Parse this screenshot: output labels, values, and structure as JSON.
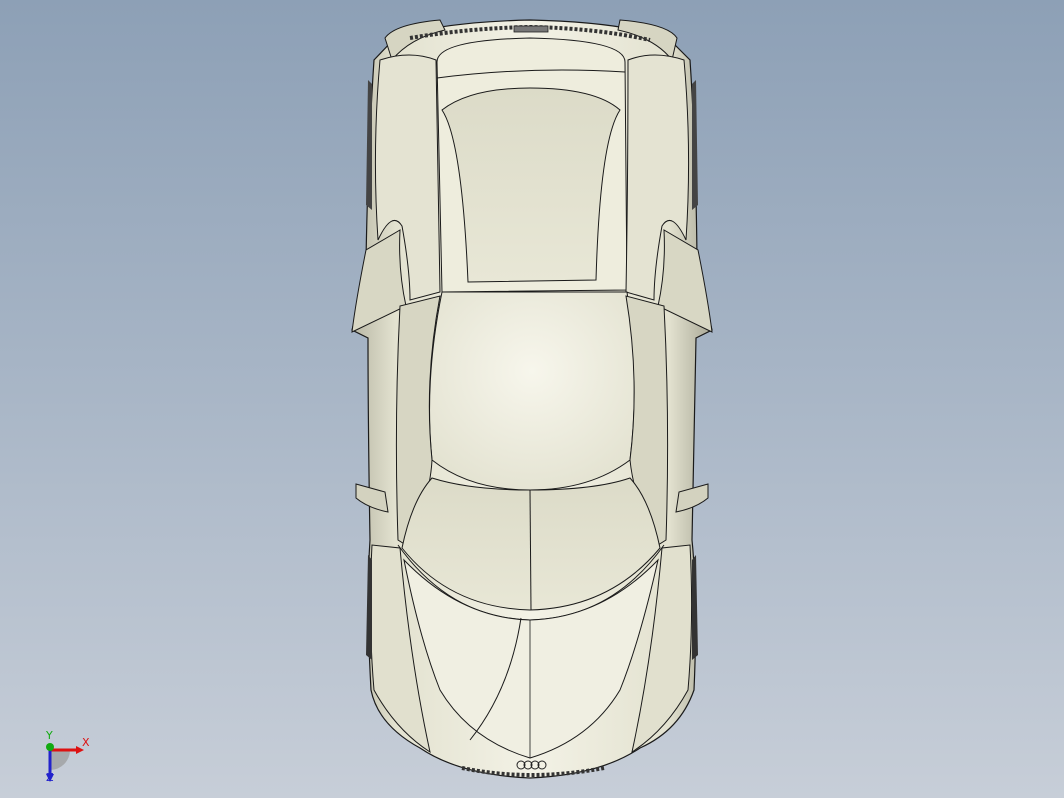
{
  "viewport": {
    "background_top": "#8da0b6",
    "background_bottom": "#c7ced8"
  },
  "model": {
    "body_color": "#ecebdb",
    "shadow_color": "#b9b8a6",
    "edge_color": "#1a1a1a"
  },
  "triad": {
    "x_label": "X",
    "y_label": "Y",
    "z_label": "Z",
    "x_color": "#dd1111",
    "y_color": "#11aa11",
    "z_color": "#2222cc"
  }
}
